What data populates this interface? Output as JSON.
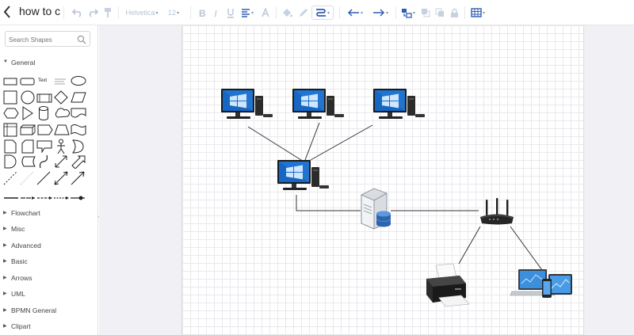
{
  "header": {
    "title": "how to c"
  },
  "toolbar": {
    "font_family": "Helvetica",
    "font_size": "12",
    "colors": {
      "disabled": "#b8c4d6",
      "active": "#2f5fb3"
    }
  },
  "sidebar": {
    "search_placeholder": "Search Shapes",
    "sections": [
      {
        "label": "General",
        "expanded": true
      },
      {
        "label": "Flowchart",
        "expanded": false
      },
      {
        "label": "Misc",
        "expanded": false
      },
      {
        "label": "Advanced",
        "expanded": false
      },
      {
        "label": "Basic",
        "expanded": false
      },
      {
        "label": "Arrows",
        "expanded": false
      },
      {
        "label": "UML",
        "expanded": false
      },
      {
        "label": "BPMN General",
        "expanded": false
      },
      {
        "label": "Clipart",
        "expanded": false
      }
    ],
    "general_text_shape": "Text",
    "collapse_glyph": "«"
  },
  "diagram": {
    "nodes": [
      {
        "id": "pc-1",
        "icon": "desktop-computer-icon"
      },
      {
        "id": "pc-2",
        "icon": "desktop-computer-icon"
      },
      {
        "id": "pc-3",
        "icon": "desktop-computer-icon"
      },
      {
        "id": "pc-hub",
        "icon": "desktop-computer-icon"
      },
      {
        "id": "server",
        "icon": "server-database-icon"
      },
      {
        "id": "router",
        "icon": "wireless-router-icon"
      },
      {
        "id": "printer",
        "icon": "printer-icon"
      },
      {
        "id": "devices",
        "icon": "laptop-tablet-phone-icon"
      }
    ],
    "edges": [
      [
        "pc-1",
        "pc-hub"
      ],
      [
        "pc-2",
        "pc-hub"
      ],
      [
        "pc-3",
        "pc-hub"
      ],
      [
        "pc-hub",
        "server"
      ],
      [
        "server",
        "router"
      ],
      [
        "router",
        "printer"
      ],
      [
        "router",
        "devices"
      ]
    ]
  }
}
